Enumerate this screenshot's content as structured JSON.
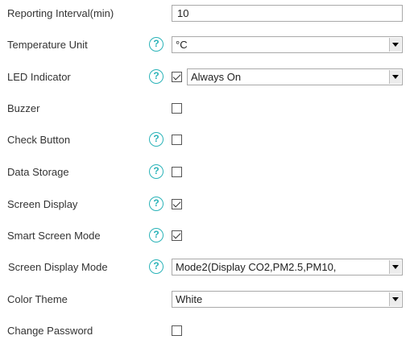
{
  "reporting_interval": {
    "label": "Reporting Interval(min)",
    "value": "10"
  },
  "temperature_unit": {
    "label": "Temperature Unit",
    "help_icon": "question-circle-icon",
    "selected": "°C"
  },
  "led_indicator": {
    "label": "LED Indicator",
    "help_icon": "question-circle-icon",
    "checked": true,
    "selected": "Always On"
  },
  "buzzer": {
    "label": "Buzzer",
    "checked": false
  },
  "check_button": {
    "label": "Check Button",
    "help_icon": "question-circle-icon",
    "checked": false
  },
  "data_storage": {
    "label": "Data Storage",
    "help_icon": "question-circle-icon",
    "checked": false
  },
  "screen_display": {
    "label": "Screen Display",
    "help_icon": "question-circle-icon",
    "checked": true
  },
  "smart_screen_mode": {
    "label": "Smart Screen Mode",
    "help_icon": "question-circle-icon",
    "checked": true
  },
  "screen_display_mode": {
    "label": "Screen Display Mode",
    "help_icon": "question-circle-icon",
    "selected": "Mode2(Display CO2,PM2.5,PM10,"
  },
  "color_theme": {
    "label": "Color Theme",
    "selected": "White"
  },
  "change_password": {
    "label": "Change Password",
    "checked": false
  },
  "help_glyph": "?",
  "colors": {
    "help_accent": "#2ab3b8",
    "border": "#a9a9a9",
    "text": "#333333"
  }
}
